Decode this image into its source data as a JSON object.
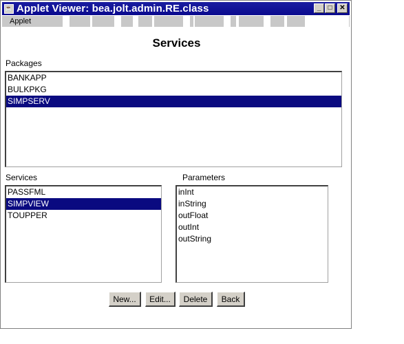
{
  "window": {
    "title": "Applet Viewer: bea.jolt.admin.RE.class",
    "min_label": "_",
    "max_label": "□",
    "close_label": "✕"
  },
  "menu": {
    "applet": "Applet"
  },
  "page": {
    "title": "Services"
  },
  "packages": {
    "label": "Packages",
    "items": [
      "BANKAPP",
      "BULKPKG",
      "SIMPSERV"
    ],
    "selected": "SIMPSERV"
  },
  "services": {
    "label": "Services",
    "items": [
      "PASSFML",
      "SIMPVIEW",
      "TOUPPER"
    ],
    "selected": "SIMPVIEW"
  },
  "parameters": {
    "label": "Parameters",
    "items": [
      "inInt",
      "inString",
      "outFloat",
      "outInt",
      "outString"
    ]
  },
  "buttons": {
    "new": "New...",
    "edit": "Edit...",
    "delete": "Delete",
    "back": "Back"
  },
  "colors": {
    "titlebar": "#0a0a8e",
    "selection": "#0a0a80"
  }
}
